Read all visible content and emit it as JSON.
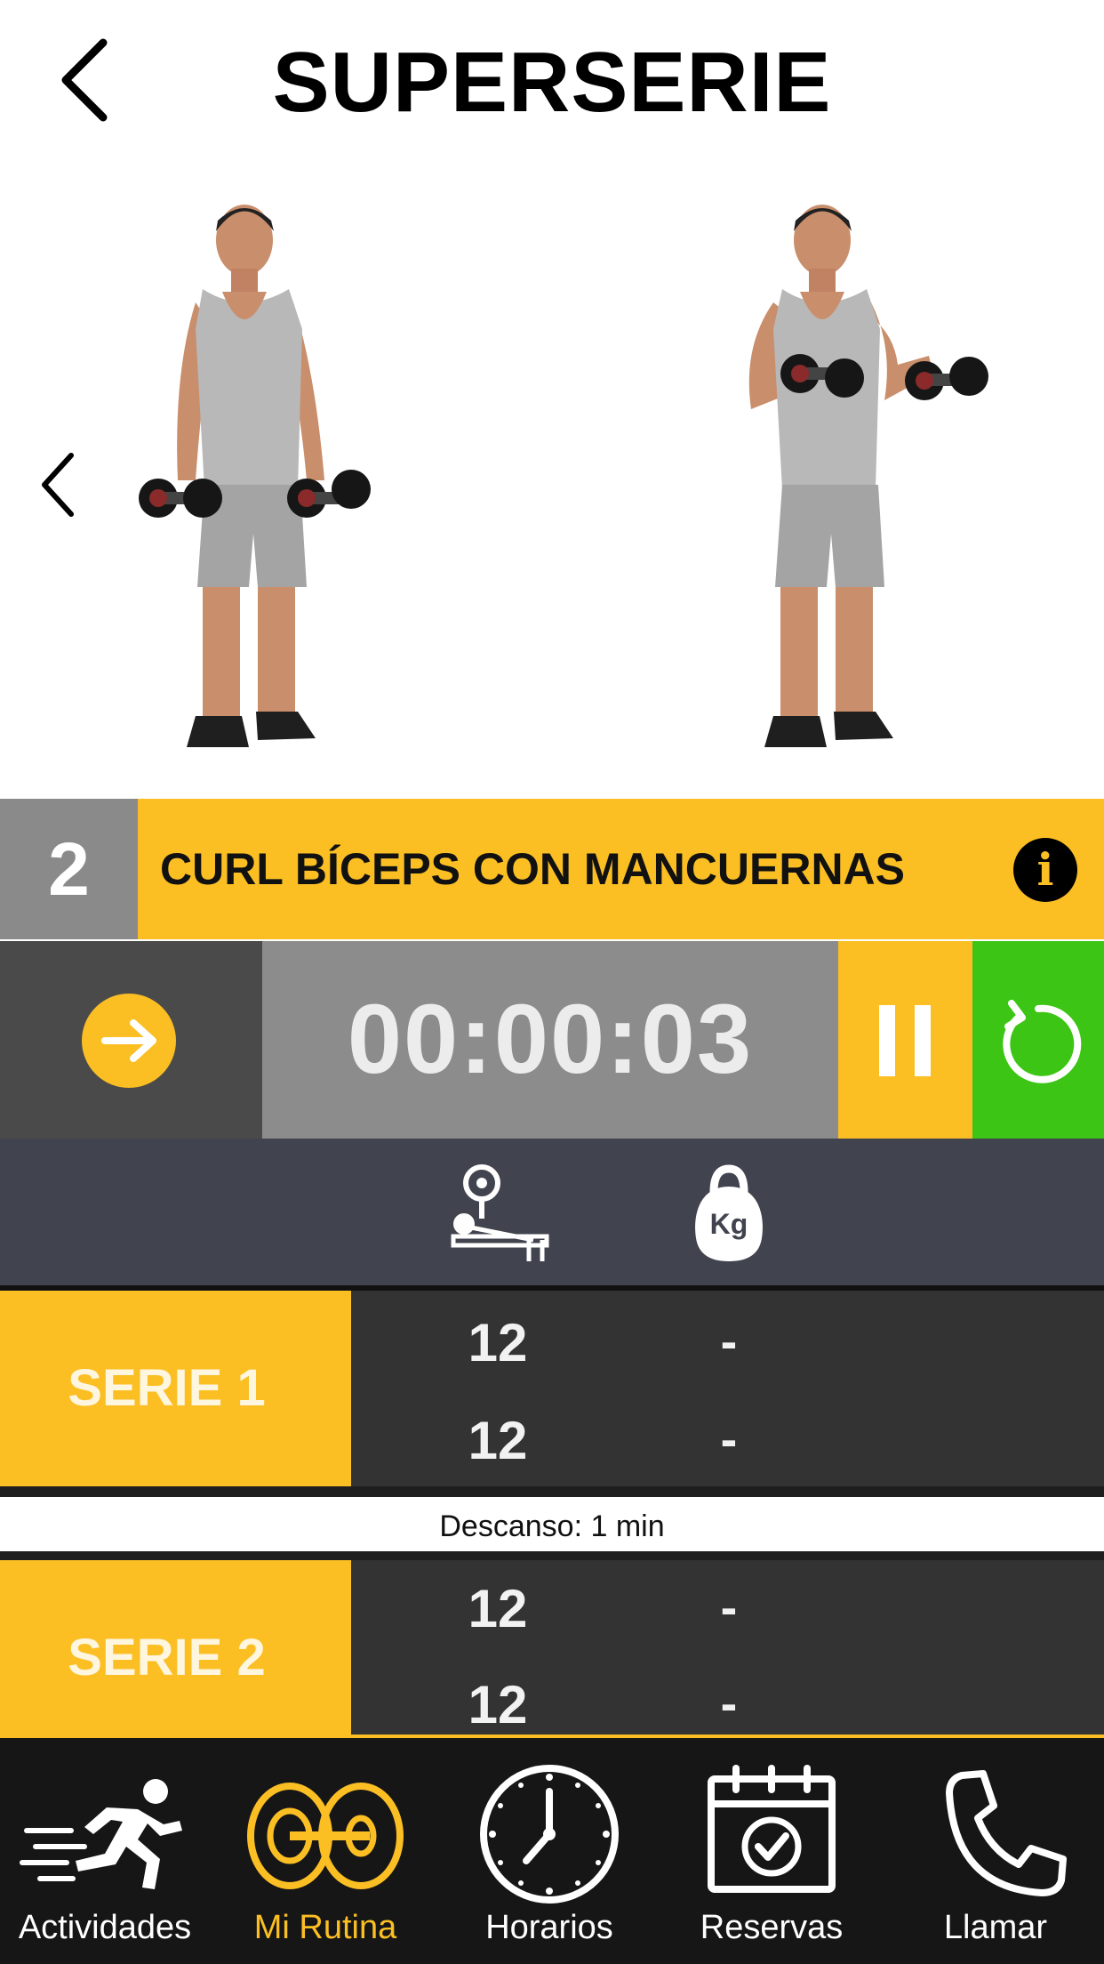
{
  "header": {
    "title": "SUPERSERIE"
  },
  "exercise": {
    "number": "2",
    "name": "CURL BÍCEPS CON MANCUERNAS",
    "info_glyph": "i"
  },
  "timer": {
    "value": "00:00:03"
  },
  "colors": {
    "accent": "#fbbf24",
    "reset": "#3cc515",
    "timer_bg": "#8c8c8c",
    "dark": "#333333"
  },
  "table": {
    "columns": [
      "bench-press-icon",
      "kettlebell-kg-icon"
    ],
    "kg_badge": "Kg",
    "series": [
      {
        "label": "SERIE 1",
        "rows": [
          {
            "reps": "12",
            "kg": "-"
          },
          {
            "reps": "12",
            "kg": "-"
          }
        ]
      },
      {
        "label": "SERIE 2",
        "rows": [
          {
            "reps": "12",
            "kg": "-"
          },
          {
            "reps": "12",
            "kg": "-"
          }
        ]
      }
    ],
    "rest": "Descanso: 1 min"
  },
  "nav": {
    "items": [
      {
        "label": "Actividades",
        "icon": "running-person-icon"
      },
      {
        "label": "Mi Rutina",
        "icon": "weight-plates-icon",
        "active": true
      },
      {
        "label": "Horarios",
        "icon": "clock-icon"
      },
      {
        "label": "Reservas",
        "icon": "calendar-check-icon"
      },
      {
        "label": "Llamar",
        "icon": "phone-icon"
      }
    ]
  }
}
